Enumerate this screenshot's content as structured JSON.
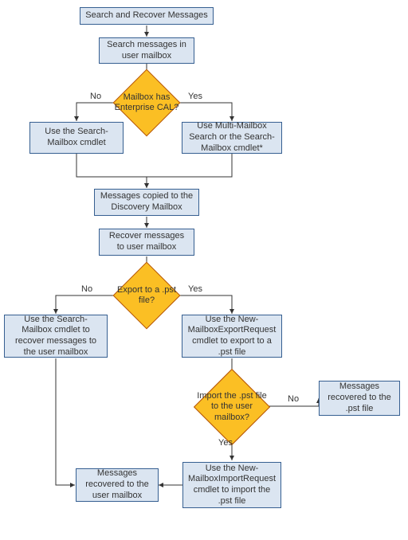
{
  "title": "Search and Recover Messages",
  "nodes": {
    "start": "Search and Recover Messages",
    "search_msgs": "Search messages in user mailbox",
    "cal_decision": "Mailbox has Enterprise CAL?",
    "use_search_mailbox": "Use the Search-Mailbox cmdlet",
    "use_multi_mailbox": "Use Multi-Mailbox Search or the Search-Mailbox cmdlet*",
    "copied_discovery": "Messages copied to the Discovery Mailbox",
    "recover_msgs": "Recover messages to user mailbox",
    "pst_decision": "Export to a .pst file?",
    "recover_direct": "Use the Search-Mailbox cmdlet to recover messages to the user mailbox",
    "export_pst": "Use the New-MailboxExportRequest cmdlet to export to a .pst file",
    "import_decision": "Import the .pst file to the user mailbox?",
    "recovered_pst": "Messages recovered to the .pst file",
    "import_pst": "Use the New-MailboxImportRequest cmdlet to import the .pst file",
    "recovered_user": "Messages recovered to the user mailbox"
  },
  "labels": {
    "yes": "Yes",
    "no": "No"
  }
}
